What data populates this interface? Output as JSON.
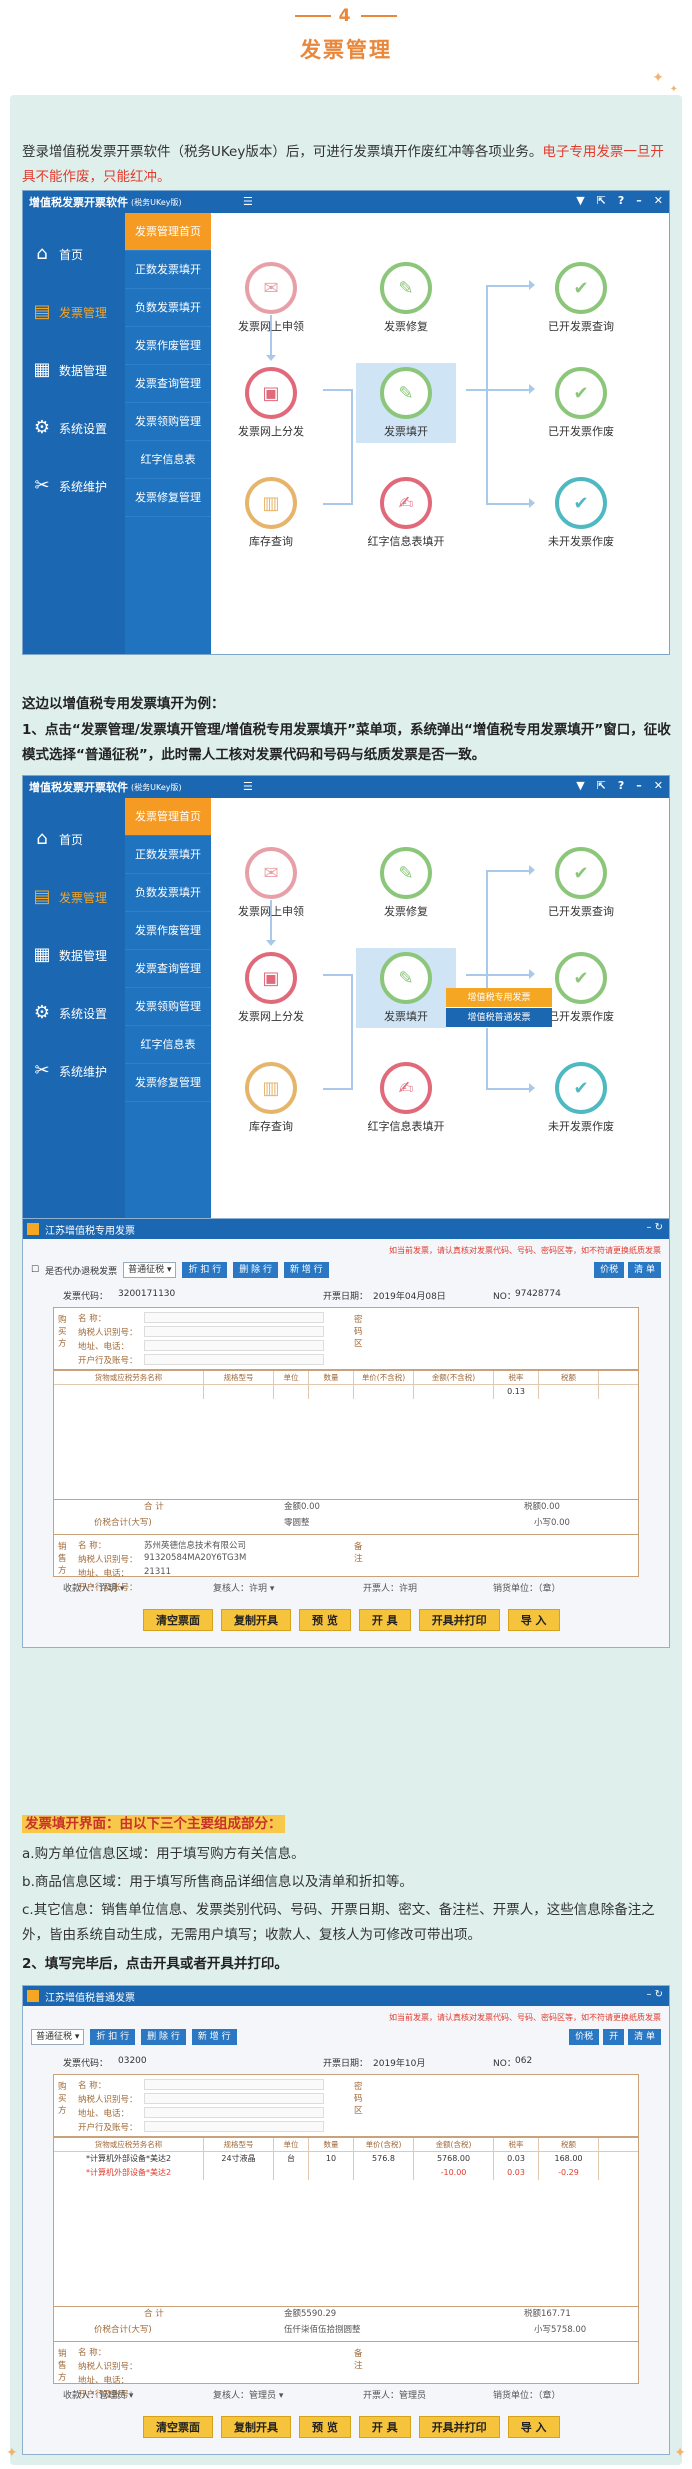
{
  "section": {
    "number": "4",
    "title": "发票管理"
  },
  "intro": {
    "text": "登录增值税发票开票软件（税务UKey版本）后，可进行发票填开作废红冲等各项业务。",
    "red_text": "电子专用发票一旦开具不能作废，只能红冲。"
  },
  "app": {
    "title": "增值税发票开票软件",
    "title_sub": "(税务UKey版)",
    "window_buttons": [
      "▼",
      "⇱",
      "?",
      "–",
      "✕"
    ],
    "nav": [
      {
        "label": "首页",
        "icon": "home-icon"
      },
      {
        "label": "发票管理",
        "icon": "invoice-icon",
        "active": true
      },
      {
        "label": "数据管理",
        "icon": "data-icon"
      },
      {
        "label": "系统设置",
        "icon": "settings-icon"
      },
      {
        "label": "系统维护",
        "icon": "tools-icon"
      }
    ],
    "subnav": [
      "发票管理首页",
      "正数发票填开",
      "负数发票填开",
      "发票作废管理",
      "发票查询管理",
      "发票领购管理",
      "红字信息表",
      "发票修复管理"
    ],
    "nodes": {
      "online_apply": "发票网上申领",
      "repair": "发票修复",
      "issued_query": "已开发票查询",
      "online_dist": "发票网上分发",
      "fill": "发票填开",
      "issued_void": "已开发票作废",
      "stock_query": "库存查询",
      "red_info": "红字信息表填开",
      "unissued_void": "未开发票作废"
    },
    "popup": [
      "增值税专用发票",
      "增值税普通发票"
    ]
  },
  "step_text": {
    "lead": "这边以增值税专用发票填开为例：",
    "step1": "1、点击“发票管理/发票填开管理/增值税专用发票填开”菜单项，系统弹出“增值税专用发票填开”窗口，征收模式选择“普通征税”，此时需人工核对发票代码和号码与纸质发票是否一致。"
  },
  "invoice1": {
    "window_title": "江苏增值税专用发票",
    "notice": "如当前发票，请认真核对发票代码、号码、密码区等，如不符请更换纸质发票",
    "checkbox_label": "是否代办退税发票",
    "mode": "普通征税",
    "buttons": [
      "折 扣 行",
      "删 除 行",
      "新 增 行"
    ],
    "right_buttons": [
      "价税",
      "清 单"
    ],
    "code_label": "发票代码",
    "code": "3200171130",
    "date_label": "开票日期",
    "date": "2019年04月08日",
    "no_label": "NO",
    "no": "97428774",
    "cols": [
      "货物或应税劳务名称",
      "规格型号",
      "单位",
      "数量",
      "单价(不含税)",
      "金额(不含税)",
      "税率",
      "税额"
    ],
    "tax_rate": "0.13",
    "total_label": "合 计",
    "amount": "金额0.00",
    "tax": "税额0.00",
    "price_tax_label": "价税合计(大写)",
    "price_tax": "零圆整",
    "small": "小写0.00",
    "seller_name": "苏州英德信息技术有限公司",
    "seller_tax": "91320584MA20Y6TG3M",
    "seller_addr": "21311",
    "payee_label": "收款人",
    "payee": "许玥",
    "reviewer_label": "复核人",
    "reviewer": "许玥",
    "drawer_label": "开票人",
    "drawer": "许玥",
    "seller_label": "销货单位：（章）",
    "bottom_buttons": [
      "清空票面",
      "复制开具",
      "预 览",
      "开 具",
      "开具并打印",
      "导 入"
    ]
  },
  "summary": {
    "heading": "发票填开界面：由以下三个主要组成部分：",
    "a": "a.购方单位信息区域：用于填写购方有关信息。",
    "b": "b.商品信息区域：用于填写所售商品详细信息以及清单和折扣等。",
    "c": "c.其它信息：销售单位信息、发票类别代码、号码、开票日期、密文、备注栏、开票人，这些信息除备注之外，皆由系统自动生成，无需用户填写；收款人、复核人为可修改可带出项。",
    "step2": "2、填写完毕后，点击开具或者开具并打印。"
  },
  "invoice2": {
    "window_title": "江苏增值税普通发票",
    "notice": "如当前发票，请认真核对发票代码、号码、密码区等，如不符请更换纸质发票",
    "mode": "普通征税",
    "buttons": [
      "折 扣 行",
      "删 除 行",
      "新 增 行"
    ],
    "right_buttons": [
      "价税",
      "开",
      "清 单"
    ],
    "code_label": "发票代码",
    "code": "03200",
    "date_label": "开票日期",
    "date": "2019年10月",
    "no_label": "NO",
    "no": "062",
    "cols": [
      "货物或应税劳务名称",
      "规格型号",
      "单位",
      "数量",
      "单价(含税)",
      "金额(含税)",
      "税率",
      "税额"
    ],
    "rows": [
      {
        "name": "*计算机外部设备*美达2",
        "spec": "24寸液晶",
        "unit": "台",
        "qty": "10",
        "price": "576.8",
        "amount": "5768.00",
        "rate": "0.03",
        "tax": "168.00",
        "red": false
      },
      {
        "name": "*计算机外部设备*美达2",
        "spec": "",
        "unit": "",
        "qty": "",
        "price": "",
        "amount": "-10.00",
        "rate": "0.03",
        "tax": "-0.29",
        "red": true
      }
    ],
    "total_label": "合 计",
    "amount": "金额5590.29",
    "tax": "税额167.71",
    "price_tax_label": "价税合计(大写)",
    "price_tax": "伍仟柒佰伍拾捌圆整",
    "small": "小写5758.00",
    "payee_label": "收款人",
    "payee": "管理员",
    "reviewer_label": "复核人",
    "reviewer": "管理员",
    "drawer_label": "开票人",
    "drawer": "管理员",
    "seller_label": "销货单位：（章）",
    "bottom_buttons": [
      "清空票面",
      "复制开具",
      "预 览",
      "开 具",
      "开具并打印",
      "导 入"
    ]
  },
  "colors": {
    "brand_blue": "#1b67b1",
    "accent_orange": "#f59a23",
    "panel_bg": "#dff0ec",
    "red_text": "#e23b2e"
  }
}
